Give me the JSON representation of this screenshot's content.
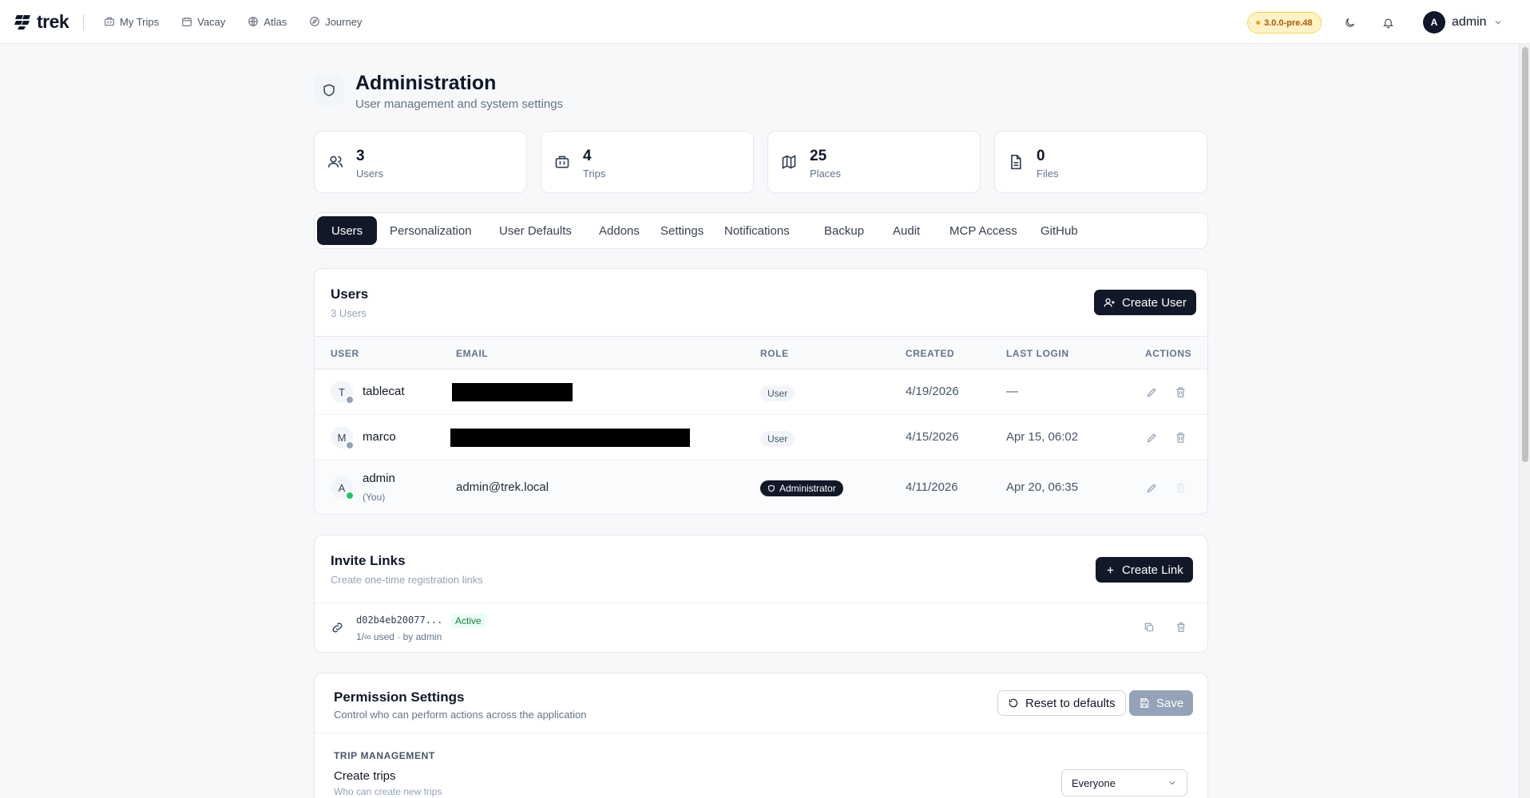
{
  "app": {
    "brand": "trek",
    "nav": [
      {
        "label": "My Trips",
        "icon": "briefcase-icon"
      },
      {
        "label": "Vacay",
        "icon": "calendar-icon"
      },
      {
        "label": "Atlas",
        "icon": "globe-icon"
      },
      {
        "label": "Journey",
        "icon": "compass-icon"
      }
    ],
    "version": "3.0.0-pre.48",
    "user": {
      "initial": "A",
      "name": "admin"
    }
  },
  "page": {
    "title": "Administration",
    "subtitle": "User management and system settings"
  },
  "stats": [
    {
      "value": "3",
      "label": "Users",
      "icon": "users-icon"
    },
    {
      "value": "4",
      "label": "Trips",
      "icon": "briefcase-icon"
    },
    {
      "value": "25",
      "label": "Places",
      "icon": "map-icon"
    },
    {
      "value": "0",
      "label": "Files",
      "icon": "file-icon"
    }
  ],
  "tabs": [
    "Users",
    "Personalization",
    "User Defaults",
    "Addons",
    "Settings",
    "Notifications",
    "Backup",
    "Audit",
    "MCP Access",
    "GitHub"
  ],
  "active_tab": "Users",
  "users_card": {
    "title": "Users",
    "count_label": "3 Users",
    "create_button": "Create User",
    "columns": [
      "USER",
      "EMAIL",
      "ROLE",
      "CREATED",
      "LAST LOGIN",
      "ACTIONS"
    ],
    "rows": [
      {
        "initial": "T",
        "name": "tablecat",
        "email": "",
        "email_redacted": true,
        "role": "User",
        "created": "4/19/2026",
        "last_login": "—",
        "online": false,
        "you": ""
      },
      {
        "initial": "M",
        "name": "marco",
        "email": "",
        "email_redacted": true,
        "role": "User",
        "created": "4/15/2026",
        "last_login": "Apr 15, 06:02",
        "online": false,
        "you": ""
      },
      {
        "initial": "A",
        "name": "admin",
        "email": "admin@trek.local",
        "email_redacted": false,
        "role": "Administrator",
        "created": "4/11/2026",
        "last_login": "Apr 20, 06:35",
        "online": true,
        "you": "(You)"
      }
    ]
  },
  "invite_card": {
    "title": "Invite Links",
    "subtitle": "Create one-time registration links",
    "create_button": "Create Link",
    "links": [
      {
        "token": "d02b4eb20077...",
        "status": "Active",
        "usage": "1/∞ used · by admin"
      }
    ]
  },
  "permissions_card": {
    "title": "Permission Settings",
    "subtitle": "Control who can perform actions across the application",
    "reset_button": "Reset to defaults",
    "save_button": "Save",
    "section": "TRIP MANAGEMENT",
    "items": [
      {
        "name": "Create trips",
        "description": "Who can create new trips",
        "value": "Everyone"
      }
    ]
  }
}
